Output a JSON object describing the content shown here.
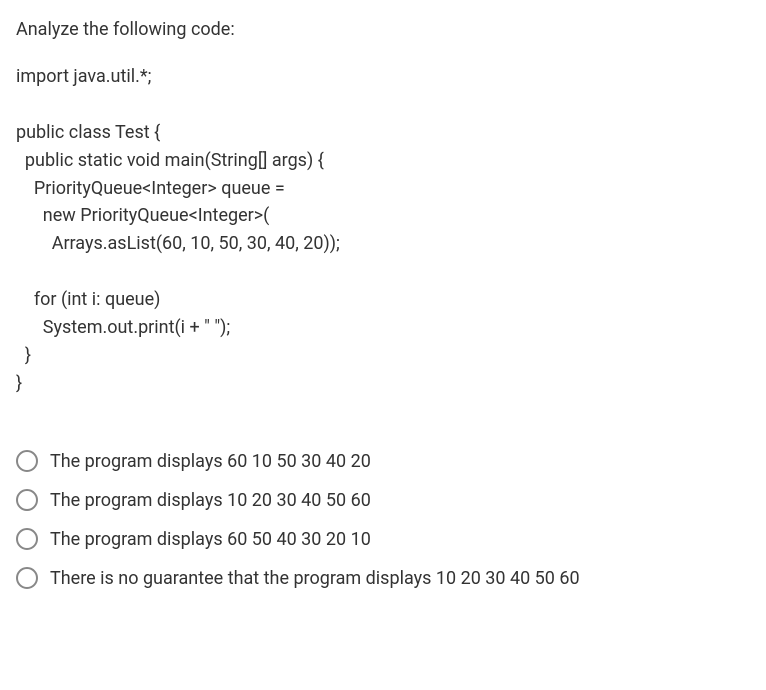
{
  "question": {
    "prompt": "Analyze the following code:",
    "code": "import java.util.*;\n\npublic class Test {\n  public static void main(String[] args) {\n    PriorityQueue<Integer> queue =\n      new PriorityQueue<Integer>(\n        Arrays.asList(60, 10, 50, 30, 40, 20));\n\n    for (int i: queue)\n      System.out.print(i + \" \");\n  }\n}"
  },
  "options": [
    {
      "label": "The program displays 60 10 50 30 40 20"
    },
    {
      "label": "The program displays 10 20 30 40 50 60"
    },
    {
      "label": "The program displays 60 50 40 30 20 10"
    },
    {
      "label": "There is no guarantee that the program displays 10 20 30 40 50 60"
    }
  ]
}
